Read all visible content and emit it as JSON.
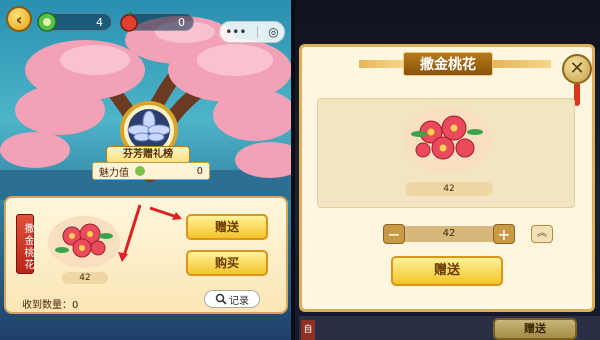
{
  "left_panel": {
    "counter_a": "4",
    "counter_b": "0",
    "mini_menu": {
      "more": "•••",
      "target": "◎"
    },
    "rank_banner": "芬芳赠礼榜",
    "charm_label": "魅力值",
    "charm_value": "0",
    "vertical_tag": "撒金桃花",
    "card_amount": "42",
    "give_label": "赠送",
    "buy_label": "购买",
    "received": "收到数量：0",
    "record_label": "记录"
  },
  "popup": {
    "title": "撒金桃花",
    "close": "✕",
    "amount": "42",
    "quantity": "42",
    "minus": "−",
    "plus": "+",
    "max": "︽",
    "give_label": "赠送"
  },
  "bottom_bar": {
    "left_tag": "自",
    "give_label": "赠送"
  },
  "colors": {
    "accent_gold": "#f4c42a",
    "blossom_pink": "#f3a1b6",
    "arrow_red": "#e02020"
  }
}
